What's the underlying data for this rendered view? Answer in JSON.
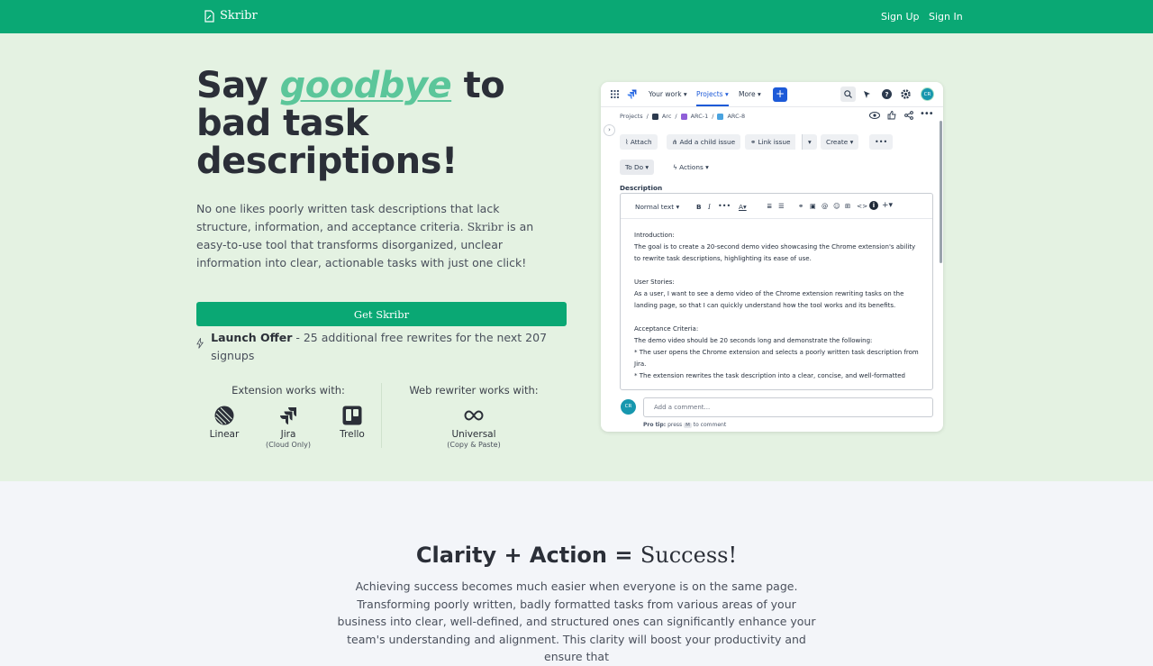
{
  "nav": {
    "brand": "Skribr",
    "sign_up": "Sign Up",
    "sign_in": "Sign In"
  },
  "hero": {
    "title_pre": "Say ",
    "title_accent": "goodbye",
    "title_post": " to bad task descriptions!",
    "lead_1": "No one likes poorly written task descriptions that lack structure, information, and acceptance criteria. ",
    "lead_brand": "Skribr",
    "lead_2": " is an easy-to-use tool that transforms disorganized, unclear information into clear, actionable tasks with just one click!",
    "cta": "Get Skribr",
    "offer_bold": "Launch Offer",
    "offer_rest": " - 25 additional free rewrites for the next 207 signups",
    "extension_heading": "Extension works with:",
    "web_heading": "Web rewriter works with:",
    "tools": [
      {
        "name": "Linear",
        "sub": ""
      },
      {
        "name": "Jira",
        "sub": "(Cloud Only)"
      },
      {
        "name": "Trello",
        "sub": ""
      },
      {
        "name": "Universal",
        "sub": "(Copy & Paste)"
      }
    ]
  },
  "mock": {
    "nav": [
      "Your work",
      "Projects",
      "More"
    ],
    "avatar": "CR",
    "crumbs": [
      "Projects",
      "/",
      "Arc",
      "/",
      "ARC-1",
      "/",
      "ARC-8"
    ],
    "buttons": {
      "attach": "Attach",
      "child": "Add a child issue",
      "link": "Link issue",
      "create": "Create",
      "todo": "To Do",
      "actions": "Actions"
    },
    "description_label": "Description",
    "format": "Normal text",
    "body": {
      "intro_h": "Introduction:",
      "intro": "The goal is to create a 20-second demo video showcasing the Chrome extension's ability to rewrite task descriptions, highlighting its ease of use.",
      "stories_h": "User Stories:",
      "stories": "As a user, I want to see a demo video of the Chrome extension rewriting tasks on the landing page, so that I can quickly understand how the tool works and its benefits.",
      "ac_h": "Acceptance Criteria:",
      "ac": "The demo video should be 20 seconds long and demonstrate the following:",
      "ac_1": "* The user opens the Chrome extension and selects a poorly written task description from Jira.",
      "ac_2": "* The extension rewrites the task description into a clear, concise, and well-formatted"
    },
    "comment_placeholder": "Add a comment...",
    "tip_bold": "Pro tip:",
    "tip_pre": " press ",
    "tip_key": "M",
    "tip_post": " to comment"
  },
  "section2": {
    "title_pre": "Clarity + Action = ",
    "title_serif": "Success!",
    "paragraph": "Achieving success becomes much easier when everyone is on the same page. Transforming poorly written, badly formatted tasks from various areas of your business into clear, well-defined, and structured ones can significantly enhance your team's understanding and alignment. This clarity will boost your productivity and ensure that"
  },
  "colors": {
    "brand": "#0aa874",
    "accent": "#5bc69a",
    "hero_bg": "#e4f2e2",
    "jira_blue": "#1d5ad8"
  }
}
